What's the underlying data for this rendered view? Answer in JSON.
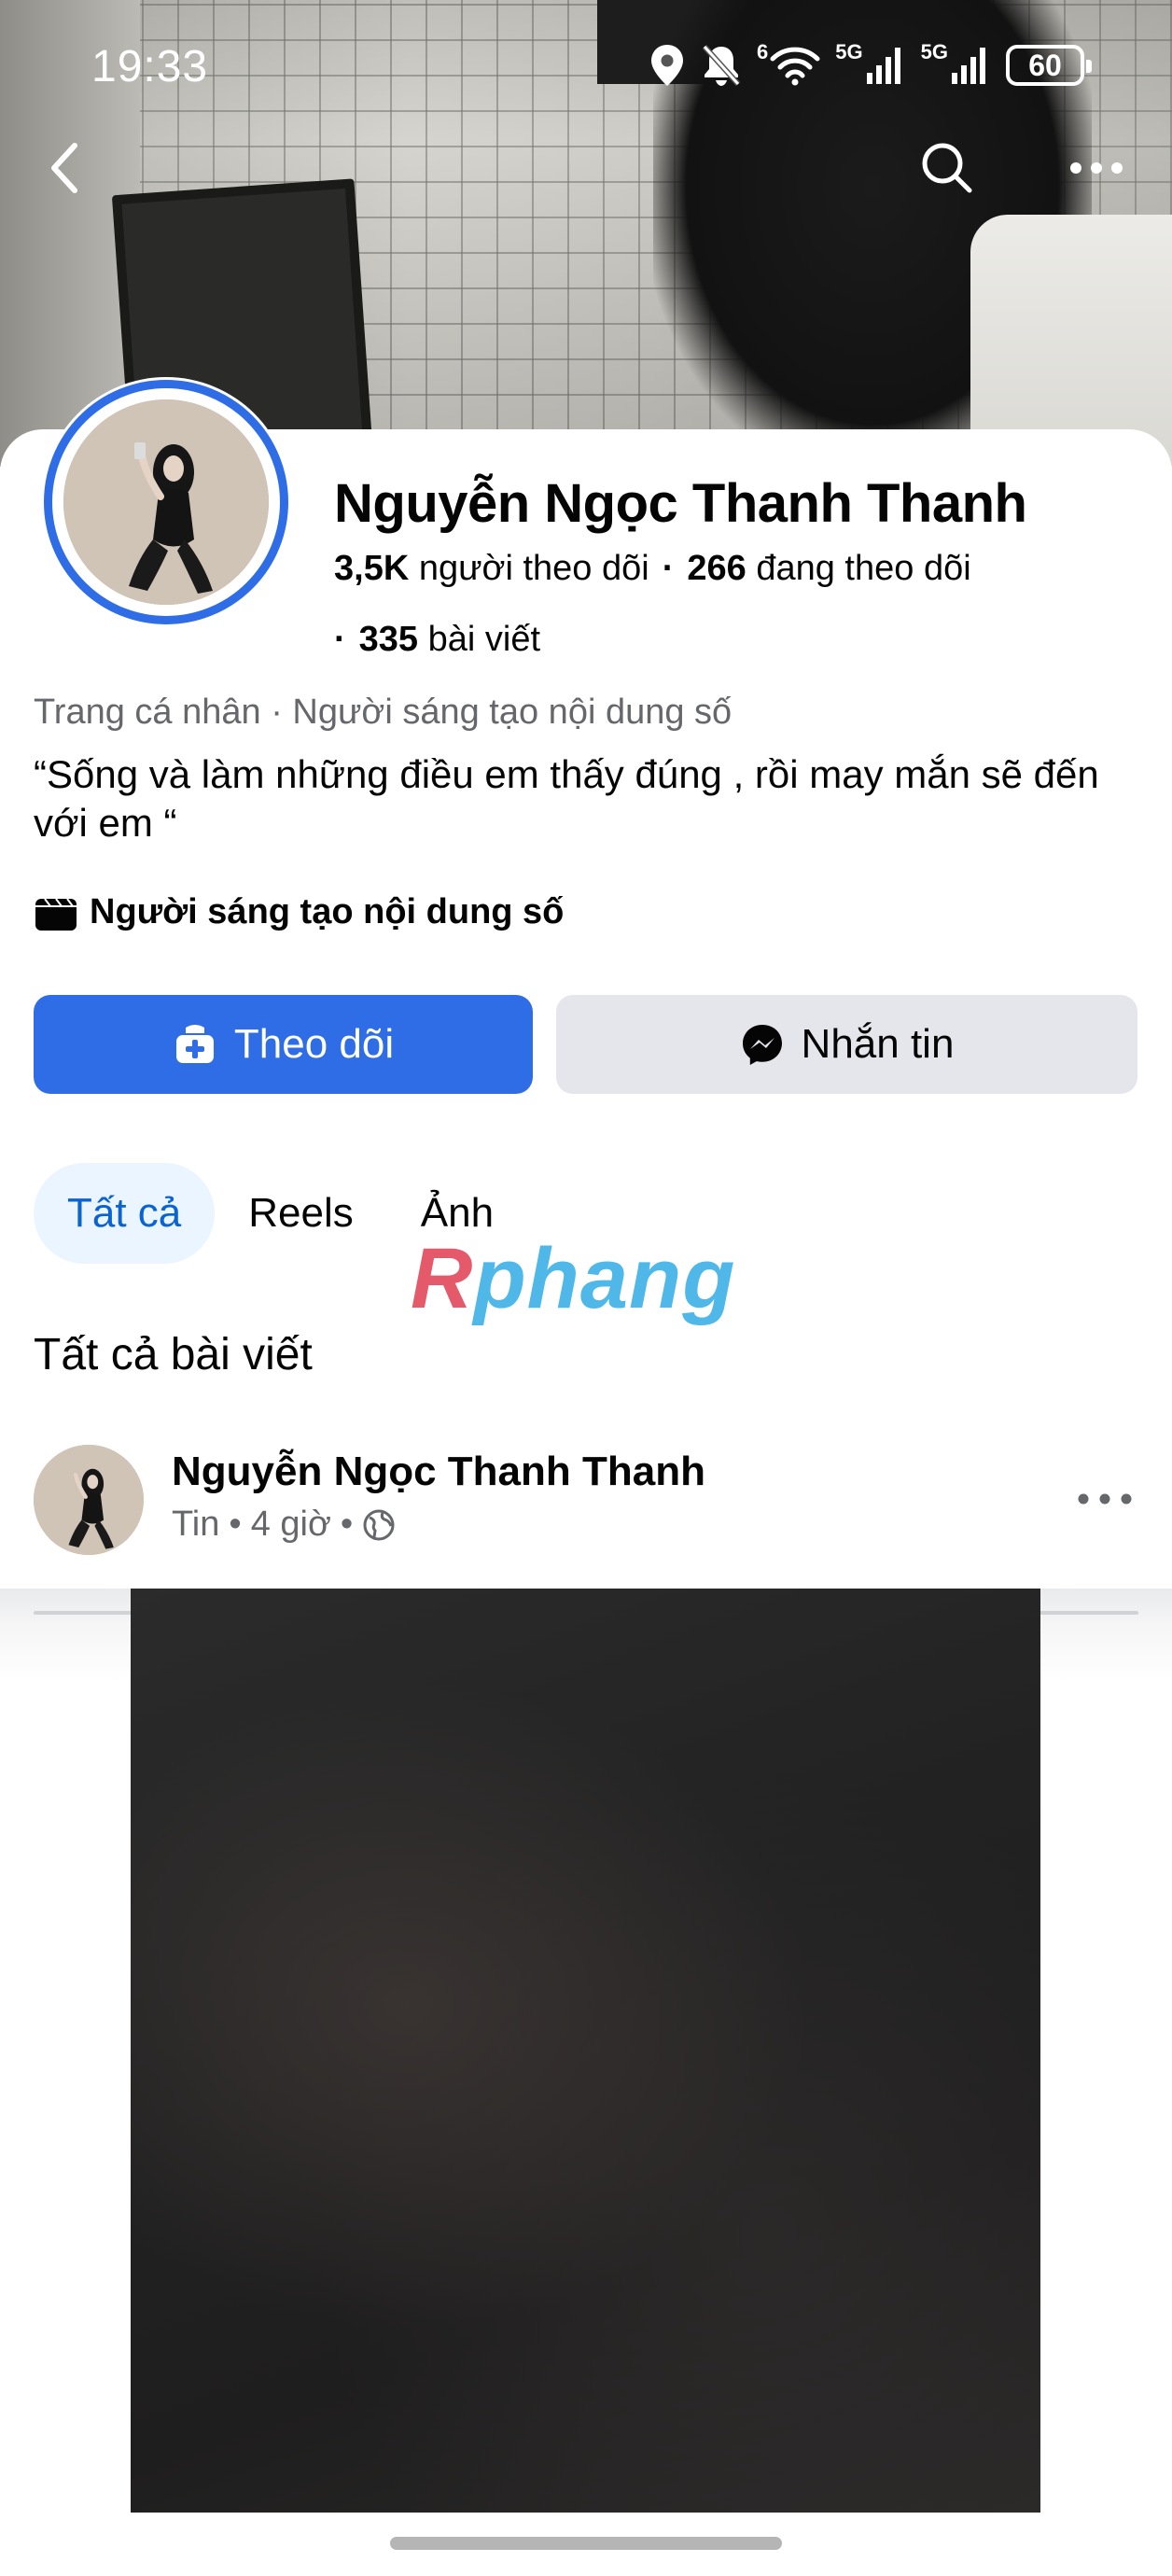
{
  "status_bar": {
    "time": "19:33",
    "network_1": "5G",
    "network_2": "5G",
    "wifi_badge": "6",
    "battery": "60"
  },
  "profile": {
    "name": "Nguyễn Ngọc Thanh Thanh",
    "followers_count": "3,5K",
    "followers_label": "người theo dõi",
    "following_count": "266",
    "following_label": "đang theo dõi",
    "posts_count": "335",
    "posts_label": "bài viết",
    "category": "Trang cá nhân · Người sáng tạo nội dung số",
    "bio": "“Sống và làm những điều em thấy đúng , rồi may mắn sẽ đến với em “",
    "creator_badge": "Người sáng tạo nội dung số"
  },
  "actions": {
    "follow_label": "Theo dõi",
    "message_label": "Nhắn tin"
  },
  "tabs": [
    {
      "label": "Tất cả",
      "active": true
    },
    {
      "label": "Reels",
      "active": false
    },
    {
      "label": "Ảnh",
      "active": false
    }
  ],
  "watermark": {
    "part1": "R",
    "part2": "phang"
  },
  "section_title": "Tất cả bài viết",
  "post": {
    "author": "Nguyễn Ngọc Thanh Thanh",
    "type": "Tin",
    "time": "4 giờ",
    "visibility_icon": "globe-icon"
  },
  "colors": {
    "primary": "#2f6de6",
    "tab_active_bg": "#ebf5ff",
    "tab_active_text": "#0a63d0",
    "secondary_button": "#e4e6eb",
    "muted_text": "#65676b"
  }
}
